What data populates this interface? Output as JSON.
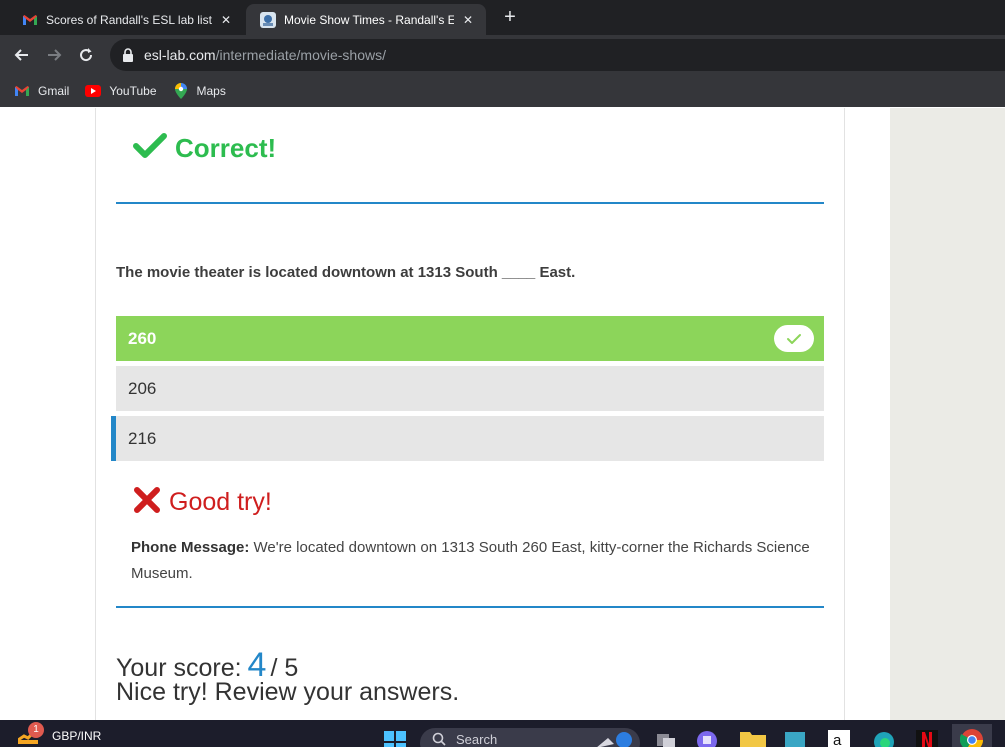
{
  "browser": {
    "tabs": [
      {
        "title": "Scores of Randall's ESL lab listen",
        "favicon": "gmail-icon",
        "active": false
      },
      {
        "title": "Movie Show Times - Randall's ESL",
        "favicon": "esl-lab-icon",
        "active": true
      }
    ],
    "url_host": "esl-lab.com",
    "url_path": "/intermediate/movie-shows/",
    "bookmarks": [
      {
        "label": "Gmail",
        "icon": "gmail-icon"
      },
      {
        "label": "YouTube",
        "icon": "youtube-icon"
      },
      {
        "label": "Maps",
        "icon": "maps-icon"
      }
    ]
  },
  "quiz": {
    "prev_result": "Correct!",
    "question": "The movie theater is located downtown at 1313 South ____ East.",
    "options": [
      {
        "label": "260",
        "state": "correct"
      },
      {
        "label": "206",
        "state": "default"
      },
      {
        "label": "216",
        "state": "selected"
      }
    ],
    "feedback": "Good try!",
    "explanation_label": "Phone Message:",
    "explanation_text": "We're located downtown on 1313 South 260 East, kitty-corner the Richards Science Museum.",
    "score_label": "Your score:",
    "score_value": "4",
    "score_total": "/ 5",
    "score_message": "Nice try! Review your answers."
  },
  "taskbar": {
    "ticker_label": "GBP/INR",
    "ticker_badge": "1",
    "search_placeholder": "Search"
  },
  "colors": {
    "correct_green": "#2dbc4f",
    "option_correct_bg": "#8cd55a",
    "wrong_red": "#cf1e1e",
    "accent_blue": "#2387c8"
  }
}
